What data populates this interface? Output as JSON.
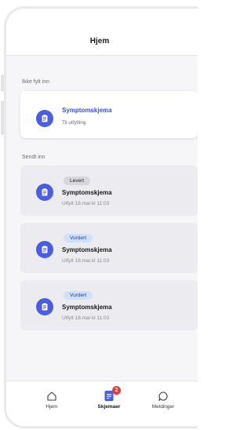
{
  "header": {
    "title": "Hjem"
  },
  "sections": {
    "todo_label": "Ikke fylt inn",
    "sent_label": "Sendt inn"
  },
  "todo_card": {
    "title": "Symptomskjema",
    "status": "Til utfylling",
    "icon": "clipboard-icon"
  },
  "sent_cards": [
    {
      "badge": "Levert",
      "title": "Symptomskjema",
      "filled": "Utfylt 18.mai kl 11:03"
    },
    {
      "badge": "Vurdert",
      "title": "Symptomskjema",
      "filled": "Utfylt 18.mai kl 11:03"
    },
    {
      "badge": "Vurdert",
      "title": "Symptomskjema",
      "filled": "Utfylt 18.mai kl 11:03"
    }
  ],
  "tabbar": {
    "tabs": [
      {
        "label": "Hjem",
        "icon": "home-icon"
      },
      {
        "label": "Skjemaer",
        "icon": "forms-icon",
        "badge": "2",
        "active": true
      },
      {
        "label": "Meldinger",
        "icon": "chat-bubble-icon"
      }
    ]
  },
  "colors": {
    "accent": "#4a5de6",
    "accent_text": "#3b50e0",
    "badge_levert": "#d6d6dc",
    "badge_vurdert": "#cfe0ff",
    "notification": "#e63b3b"
  }
}
